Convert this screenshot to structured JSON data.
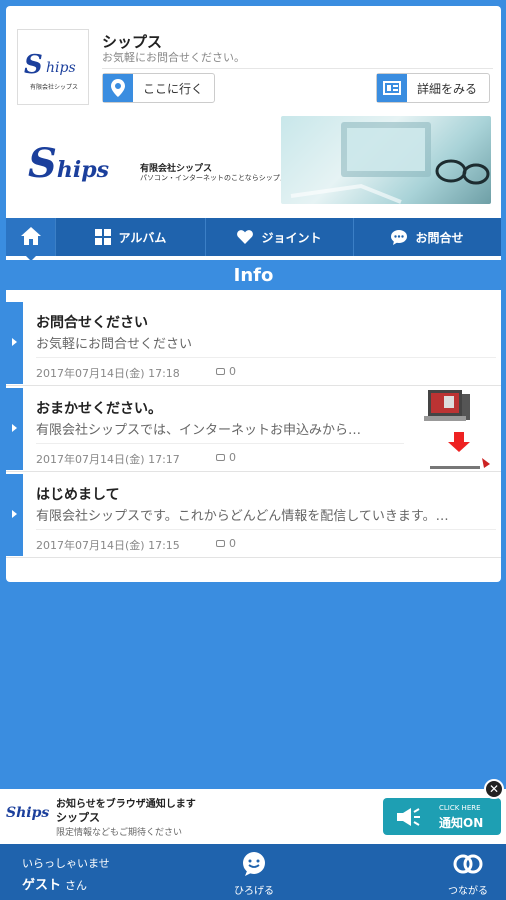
{
  "shop": {
    "name": "シップス",
    "subtitle": "お気軽にお問合せください。",
    "logo_text": "hips",
    "logo_sub": "有限会社シップス"
  },
  "buttons": {
    "go_label": "ここに行く",
    "detail_label": "詳細をみる"
  },
  "banner": {
    "company": "有限会社シップス",
    "tagline": "パソコン・インターネットのことならシップスへおまかせください。",
    "logo_text": "hips"
  },
  "nav": {
    "items": [
      {
        "label": "アルバム"
      },
      {
        "label": "ジョイント"
      },
      {
        "label": "お問合せ"
      }
    ]
  },
  "section_title": "Info",
  "posts": [
    {
      "title": "お問合せください",
      "body": "お気軽にお問合せください",
      "date": "2017年07月14日(金) 17:18",
      "comments": "0"
    },
    {
      "title": "おまかせください。",
      "body": "有限会社シップスでは、インターネットお申込みから…",
      "date": "2017年07月14日(金) 17:17",
      "comments": "0"
    },
    {
      "title": "はじめまして",
      "body": "有限会社シップスです。これからどんどん情報を配信していきます。…",
      "date": "2017年07月14日(金) 17:15",
      "comments": "0"
    }
  ],
  "push": {
    "line1": "お知らせをブラウザ通知します",
    "line2": "シップス",
    "line3": "限定情報などもご期待ください",
    "btn_small": "CLICK HERE",
    "btn_main": "通知ON"
  },
  "footer": {
    "welcome": "いらっしゃいませ",
    "guest": "ゲスト",
    "san": "さん",
    "spread_label": "ひろげる",
    "connect_label": "つながる"
  },
  "colors": {
    "accent": "#3a8de0",
    "nav": "#1f63ad",
    "notify_btn": "#1e9fb3"
  }
}
